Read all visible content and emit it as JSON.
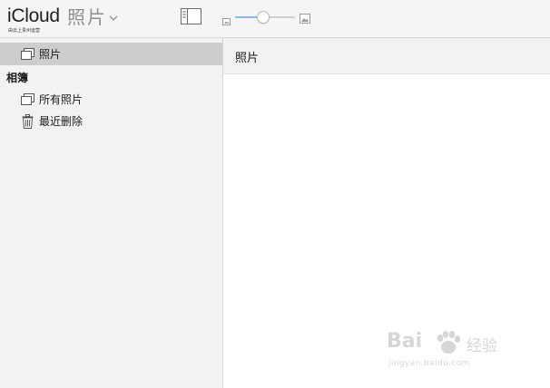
{
  "header": {
    "brand": "iCloud",
    "brand_subtitle": "由云上贵州运营",
    "app_title": "照片",
    "zoom": {
      "level": 0.47
    }
  },
  "sidebar": {
    "top_item": {
      "label": "照片",
      "icon": "photos-stack-icon",
      "selected": true
    },
    "section_title": "相簿",
    "albums": [
      {
        "label": "所有照片",
        "icon": "photos-stack-icon"
      },
      {
        "label": "最近删除",
        "icon": "trash-icon"
      }
    ]
  },
  "main": {
    "title": "照片"
  },
  "watermark": {
    "brand_text": "Bai",
    "brand_cn": "经验",
    "url": "jingyan.baidu.com"
  },
  "colors": {
    "slider_fill": "#8ab6ea",
    "selected_row": "#cdcdcd",
    "sidebar_bg": "#f2f2f2"
  }
}
